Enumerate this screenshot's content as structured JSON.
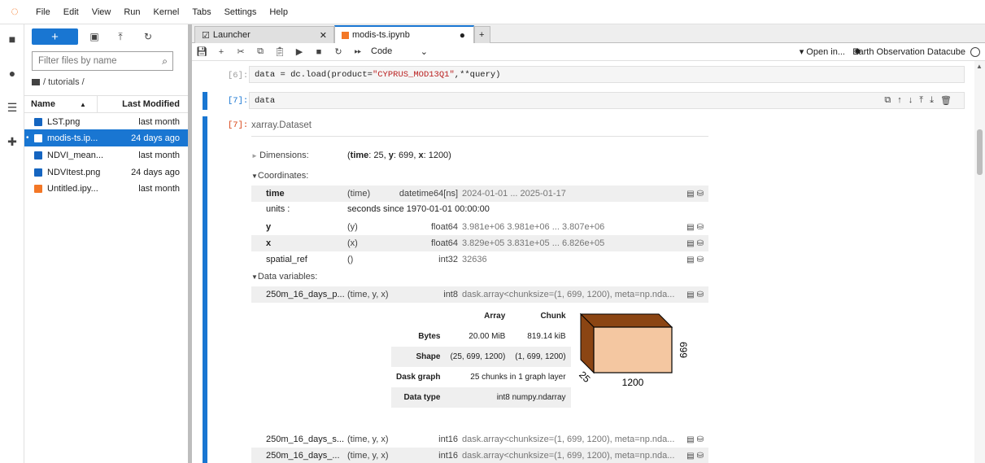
{
  "menubar": {
    "items": [
      "File",
      "Edit",
      "View",
      "Run",
      "Kernel",
      "Tabs",
      "Settings",
      "Help"
    ]
  },
  "filebrowser": {
    "filter_placeholder": "Filter files by name",
    "breadcrumb": "/ tutorials /",
    "header": {
      "name": "Name",
      "modified": "Last Modified"
    },
    "files": [
      {
        "name": "LST.png",
        "modified": "last month"
      },
      {
        "name": "modis-ts.ip...",
        "modified": "24 days ago"
      },
      {
        "name": "NDVI_mean...",
        "modified": "last month"
      },
      {
        "name": "NDVItest.png",
        "modified": "24 days ago"
      },
      {
        "name": "Untitled.ipy...",
        "modified": "last month"
      }
    ]
  },
  "tabs": {
    "launcher": "Launcher",
    "notebook": "modis-ts.ipynb"
  },
  "toolbar": {
    "celltype": "Code",
    "open_in": "Open in...",
    "kernel": "Earth Observation Datacube"
  },
  "cells": {
    "c6_prompt": "[6]:",
    "c6_code_pre": "data = dc.load(product=",
    "c6_code_str": "\"CYPRUS_MOD13Q1\"",
    "c6_code_post": ",**query)",
    "c7_prompt": "[7]:",
    "c7_code": "data",
    "out_prompt": "[7]:"
  },
  "xarray": {
    "type": "xarray.Dataset",
    "dimensions_label": "Dimensions:",
    "dimensions_pre": "(",
    "dim_time_name": "time",
    "dim_time_val": ": 25, ",
    "dim_y_name": "y",
    "dim_y_val": ": 699, ",
    "dim_x_name": "x",
    "dim_x_val": ": 1200)",
    "coordinates_label": "Coordinates:",
    "coords": [
      {
        "name": "time",
        "dims": "(time)",
        "dtype": "datetime64[ns]",
        "preview": "2024-01-01 ... 2025-01-17"
      },
      {
        "name": "units :",
        "attr": "seconds since 1970-01-01 00:00:00"
      },
      {
        "name": "y",
        "dims": "(y)",
        "dtype": "float64",
        "preview": "3.981e+06 3.981e+06 ... 3.807e+06"
      },
      {
        "name": "x",
        "dims": "(x)",
        "dtype": "float64",
        "preview": "3.829e+05 3.831e+05 ... 6.826e+05"
      },
      {
        "name": "spatial_ref",
        "dims": "()",
        "dtype": "int32",
        "preview": "32636"
      }
    ],
    "datavars_label": "Data variables:",
    "vars": [
      {
        "name": "250m_16_days_p...",
        "dims": "(time, y, x)",
        "dtype": "int8",
        "preview": "dask.array<chunksize=(1, 699, 1200), meta=np.nda..."
      },
      {
        "name": "250m_16_days_s...",
        "dims": "(time, y, x)",
        "dtype": "int16",
        "preview": "dask.array<chunksize=(1, 699, 1200), meta=np.nda..."
      },
      {
        "name": "250m_16_days_...",
        "dims": "(time, y, x)",
        "dtype": "int16",
        "preview": "dask.array<chunksize=(1, 699, 1200), meta=np.nda..."
      }
    ],
    "array_table": {
      "h_array": "Array",
      "h_chunk": "Chunk",
      "bytes_label": "Bytes",
      "bytes_array": "20.00 MiB",
      "bytes_chunk": "819.14 kiB",
      "shape_label": "Shape",
      "shape_array": "(25, 699, 1200)",
      "shape_chunk": "(1, 699, 1200)",
      "graph_label": "Dask graph",
      "graph_val": "25 chunks in 1 graph layer",
      "dtype_label": "Data type",
      "dtype_val": "int8 numpy.ndarray"
    },
    "cube": {
      "x_label": "1200",
      "y_label": "699",
      "z_label": "25",
      "front_color": "#f4c7a1",
      "side_color": "#8b4513"
    }
  }
}
